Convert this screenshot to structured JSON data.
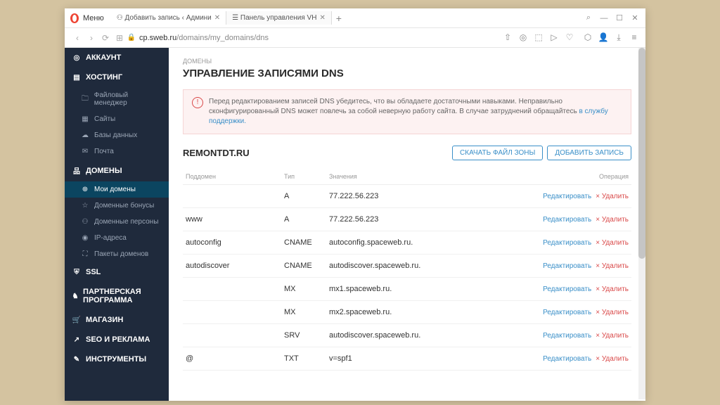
{
  "browser": {
    "menu": "Меню",
    "tabs": [
      {
        "title": "Добавить запись ‹ Админи",
        "active": false
      },
      {
        "title": "Панель управления VH",
        "active": true
      }
    ],
    "url_host": "cp.sweb.ru",
    "url_path": "/domains/my_domains/dns"
  },
  "sidebar": [
    {
      "label": "АККАУНТ",
      "icon": "◎",
      "type": "top"
    },
    {
      "label": "ХОСТИНГ",
      "icon": "▤",
      "type": "top"
    },
    {
      "label": "Файловый менеджер",
      "icon": "🗀",
      "type": "sub"
    },
    {
      "label": "Сайты",
      "icon": "▦",
      "type": "sub"
    },
    {
      "label": "Базы данных",
      "icon": "☁",
      "type": "sub"
    },
    {
      "label": "Почта",
      "icon": "✉",
      "type": "sub"
    },
    {
      "label": "ДОМЕНЫ",
      "icon": "品",
      "type": "top"
    },
    {
      "label": "Мои домены",
      "icon": "⊕",
      "type": "sub",
      "active": true
    },
    {
      "label": "Доменные бонусы",
      "icon": "☆",
      "type": "sub"
    },
    {
      "label": "Доменные персоны",
      "icon": "⚇",
      "type": "sub"
    },
    {
      "label": "IP-адреса",
      "icon": "◉",
      "type": "sub"
    },
    {
      "label": "Пакеты доменов",
      "icon": "⛶",
      "type": "sub"
    },
    {
      "label": "SSL",
      "icon": "⛨",
      "type": "top"
    },
    {
      "label": "ПАРТНЕРСКАЯ ПРОГРАММА",
      "icon": "♞",
      "type": "top"
    },
    {
      "label": "МАГАЗИН",
      "icon": "🛒",
      "type": "top"
    },
    {
      "label": "SEO И РЕКЛАМА",
      "icon": "↗",
      "type": "top"
    },
    {
      "label": "ИНСТРУМЕНТЫ",
      "icon": "✎",
      "type": "top"
    }
  ],
  "page": {
    "breadcrumb": "ДОМЕНЫ",
    "title": "УПРАВЛЕНИЕ ЗАПИСЯМИ DNS",
    "alert": {
      "text": "Перед редактированием записей DNS убедитесь, что вы обладаете достаточными навыками. Неправильно сконфигурированный DNS может повлечь за собой неверную работу сайта. В случае затруднений обращайтесь ",
      "link": "в службу поддержки."
    },
    "domain": "REMONTDT.RU",
    "buttons": {
      "download": "СКАЧАТЬ ФАЙЛ ЗОНЫ",
      "add": "ДОБАВИТЬ ЗАПИСЬ"
    },
    "columns": {
      "sub": "Поддомен",
      "type": "Тип",
      "value": "Значения",
      "op": "Операция"
    },
    "actions": {
      "edit": "Редактировать",
      "delete": "Удалить"
    },
    "records": [
      {
        "sub": "",
        "type": "A",
        "value": "77.222.56.223"
      },
      {
        "sub": "www",
        "type": "A",
        "value": "77.222.56.223"
      },
      {
        "sub": "autoconfig",
        "type": "CNAME",
        "value": "autoconfig.spaceweb.ru."
      },
      {
        "sub": "autodiscover",
        "type": "CNAME",
        "value": "autodiscover.spaceweb.ru."
      },
      {
        "sub": "",
        "type": "MX",
        "value": "mx1.spaceweb.ru."
      },
      {
        "sub": "",
        "type": "MX",
        "value": "mx2.spaceweb.ru."
      },
      {
        "sub": "",
        "type": "SRV",
        "value": "autodiscover.spaceweb.ru."
      },
      {
        "sub": "@",
        "type": "TXT",
        "value": "v=spf1"
      }
    ]
  }
}
